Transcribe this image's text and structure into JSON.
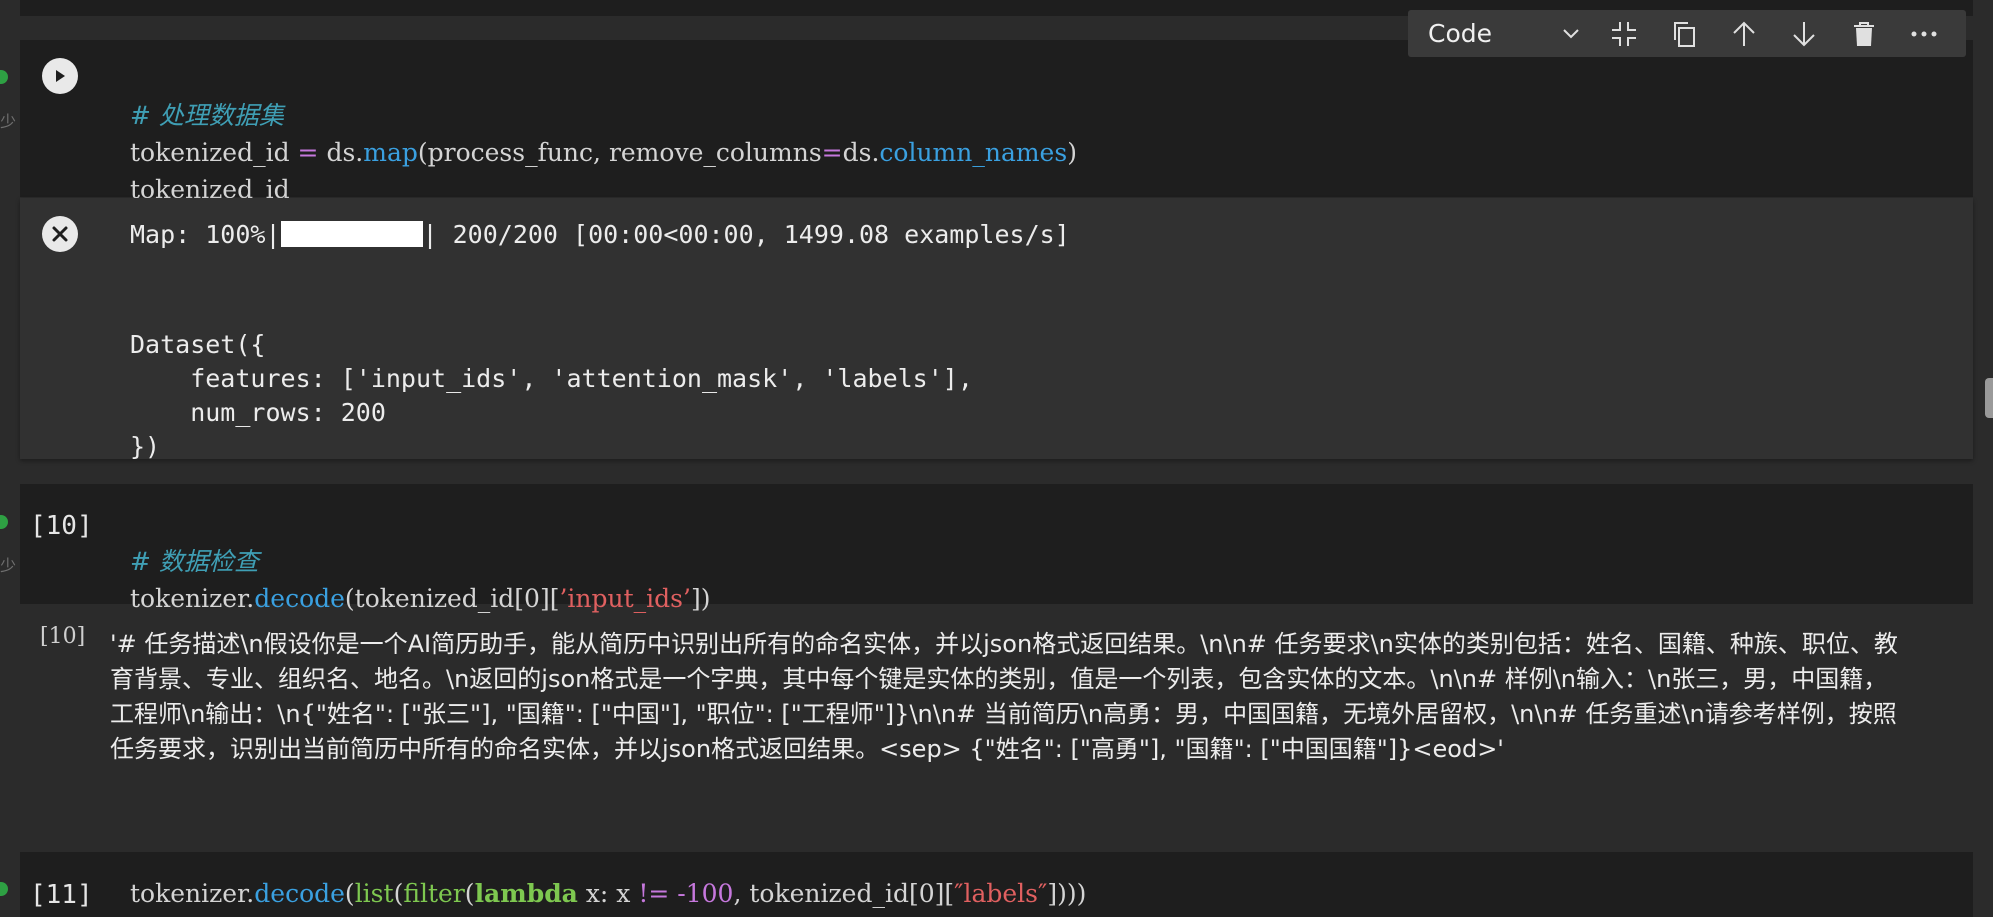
{
  "toolbar": {
    "cell_type": "Code",
    "icons": [
      "chevron-down-icon",
      "collapse-icon",
      "copy-icon",
      "move-up-icon",
      "move-down-icon",
      "delete-icon",
      "more-icon"
    ]
  },
  "cell9": {
    "code_comment": "# 处理数据集",
    "code_line2_var": "tokenized_id",
    "code_line2_eq": " = ",
    "code_line2_obj": "ds.",
    "code_line2_fn": "map",
    "code_line2_open": "(process_func, ",
    "code_line2_param": "remove_columns",
    "code_line2_eq2": "=",
    "code_line2_obj2": "ds.",
    "code_line2_prop": "column_names",
    "code_line2_close": ")",
    "code_line3": "tokenized_id",
    "progress_prefix": "Map: 100%|",
    "progress_value": 1.0,
    "progress_suffix": "| 200/200 [00:00<00:00, 1499.08 examples/s]",
    "output_lines": [
      "Dataset({",
      "    features: ['input_ids', 'attention_mask', 'labels'],",
      "    num_rows: 200",
      "})"
    ]
  },
  "cell10": {
    "exec_count": "[10]",
    "out_count": "[10]",
    "code_comment": "# 数据检查",
    "code_obj": "tokenizer.",
    "code_fn": "decode",
    "code_rest1": "(tokenized_id[0][",
    "code_str": "’input_ids’",
    "code_rest2": "])",
    "output": "'# 任务描述\\n假设你是一个AI简历助手，能从简历中识别出所有的命名实体，并以json格式返回结果。\\n\\n# 任务要求\\n实体的类别包括：姓名、国籍、种族、职位、教育背景、专业、组织名、地名。\\n返回的json格式是一个字典，其中每个键是实体的类别，值是一个列表，包含实体的文本。\\n\\n# 样例\\n输入：\\n张三，男，中国籍，工程师\\n输出：\\n{\"姓名\": [\"张三\"], \"国籍\": [\"中国\"], \"职位\": [\"工程师\"]}\\n\\n# 当前简历\\n高勇：男，中国国籍，无境外居留权，\\n\\n# 任务重述\\n请参考样例，按照任务要求，识别出当前简历中所有的命名实体，并以json格式返回结果。<sep> {\"姓名\": [\"高勇\"], \"国籍\": [\"中国国籍\"]}<eod>'"
  },
  "cell11": {
    "exec_count": "[11]",
    "code_obj": "tokenizer.",
    "code_fn": "decode",
    "code_p1": "(",
    "code_list": "list",
    "code_p2": "(",
    "code_filter": "filter",
    "code_p3": "(",
    "code_lambda": "lambda",
    "code_x": " x: x ",
    "code_ne": "!=",
    "code_sp": " ",
    "code_num": "-100",
    "code_mid": ", tokenized_id[0][",
    "code_str": "″labels″",
    "code_end": "])))"
  },
  "side": {
    "char": "少"
  }
}
